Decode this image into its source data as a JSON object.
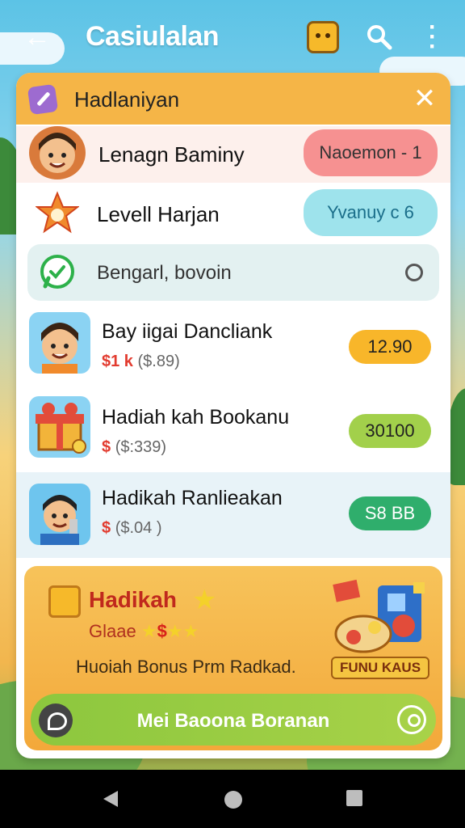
{
  "app": {
    "title": "Casiulalan"
  },
  "modal": {
    "title": "Hadlaniyan",
    "rows": [
      {
        "label": "Lenagn Baminy",
        "pill": "Naoemon - 1"
      },
      {
        "label": "Levell Harjan",
        "pill": "Yvanuy c 6"
      },
      {
        "label": "Bengarl, bovoin"
      }
    ],
    "items": [
      {
        "title": "Bay iigai Dancliank",
        "sub_icons": "$1 k",
        "sub": "($.89)",
        "price": "12.90",
        "price_color": "#f8b62a"
      },
      {
        "title": "Hadiah kah Bookanu",
        "sub_icons": "$",
        "sub": "($:339)",
        "price": "30100",
        "price_color": "#a2d04b"
      },
      {
        "title": "Hadikah Ranlieakan",
        "sub_icons": "$",
        "sub": "($.04 )",
        "price": "S8 BB",
        "price_color": "#2fae6c"
      }
    ],
    "promo": {
      "title": "Hadikah",
      "rating_label": "Glaae",
      "rating_mid": "$",
      "description": "Huoiah Bonus Prm Radkad.",
      "art_label": "FUNU KAUS",
      "cta_label": "Mei Baoona Boranan"
    }
  },
  "colors": {
    "header": "#f5b547",
    "accent": "#5cc3e6"
  }
}
